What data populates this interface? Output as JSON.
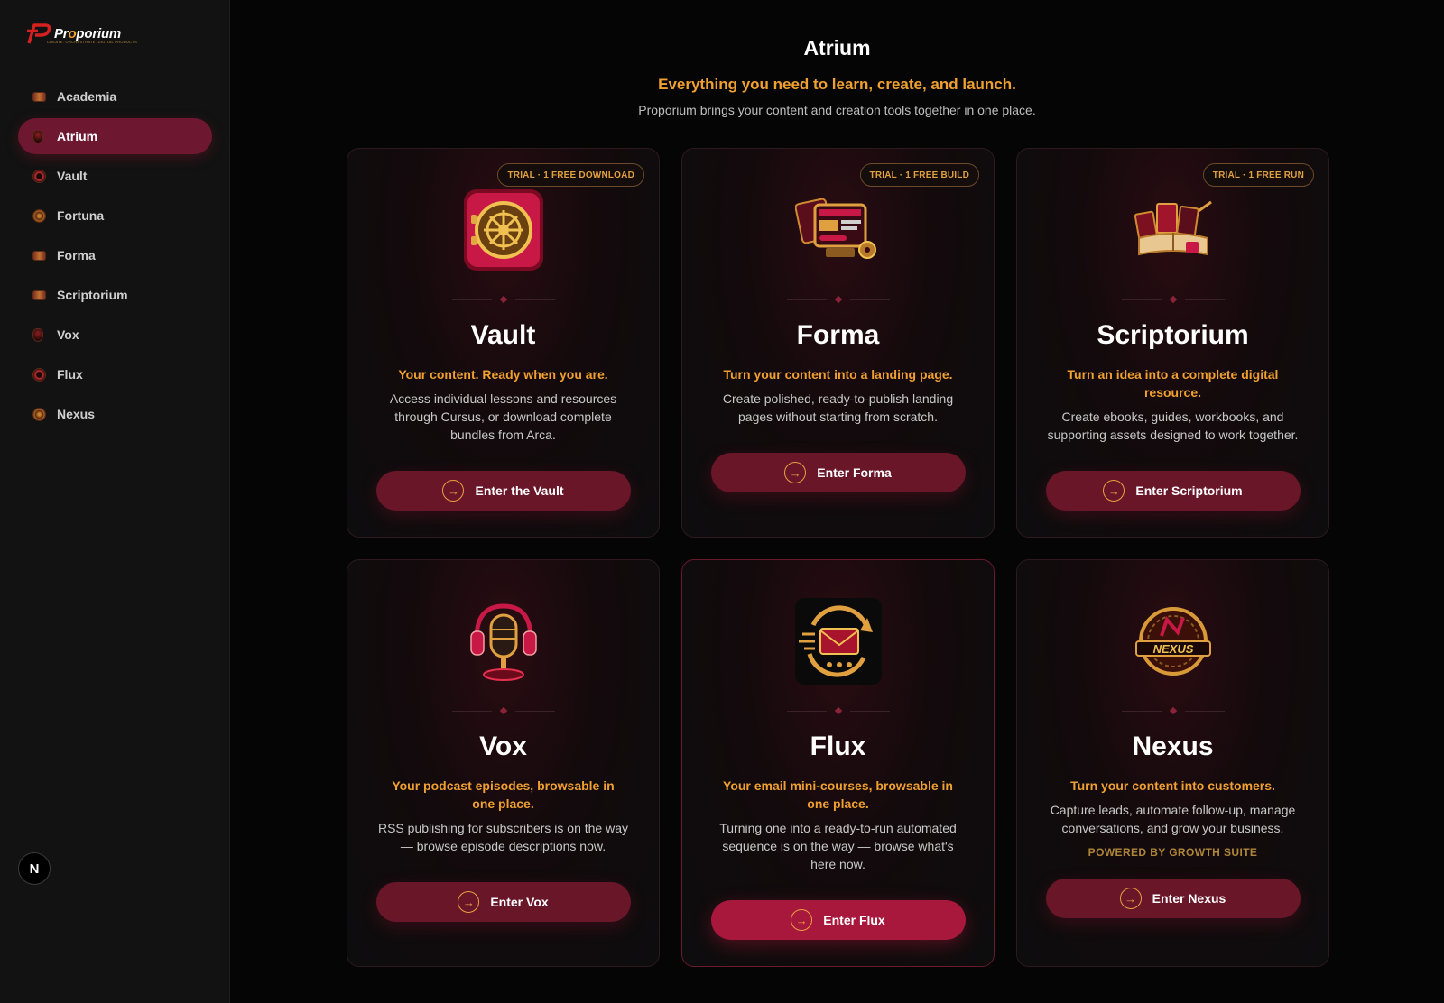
{
  "brand": {
    "name_prefix": "Pr",
    "name_o": "o",
    "name_suffix": "porium",
    "subtext": "CREATE. ORCHESTRATE. DIGITAL PRODUCTS"
  },
  "sidebar": {
    "items": [
      {
        "label": "Academia",
        "icon": "academia-icon"
      },
      {
        "label": "Atrium",
        "icon": "atrium-icon",
        "active": true
      },
      {
        "label": "Vault",
        "icon": "vault-icon"
      },
      {
        "label": "Fortuna",
        "icon": "fortuna-icon"
      },
      {
        "label": "Forma",
        "icon": "forma-icon"
      },
      {
        "label": "Scriptorium",
        "icon": "scriptorium-icon"
      },
      {
        "label": "Vox",
        "icon": "vox-icon"
      },
      {
        "label": "Flux",
        "icon": "flux-icon"
      },
      {
        "label": "Nexus",
        "icon": "nexus-icon"
      }
    ],
    "badge": "N"
  },
  "header": {
    "title": "Atrium",
    "tagline": "Everything you need to learn, create, and launch.",
    "description": "Proporium brings your content and creation tools together in one place."
  },
  "cards": [
    {
      "badge": "TRIAL · 1 FREE DOWNLOAD",
      "title": "Vault",
      "tagline": "Your content. Ready when you are.",
      "description": "Access individual lessons and resources through Cursus, or download complete bundles from Arca.",
      "button": "Enter the Vault",
      "icon": "vault-safe-icon"
    },
    {
      "badge": "TRIAL · 1 FREE BUILD",
      "title": "Forma",
      "tagline": "Turn your content into a landing page.",
      "description": "Create polished, ready-to-publish landing pages without starting from scratch.",
      "button": "Enter Forma",
      "icon": "landing-page-icon"
    },
    {
      "badge": "TRIAL · 1 FREE RUN",
      "title": "Scriptorium",
      "tagline": "Turn an idea into a complete digital resource.",
      "description": "Create ebooks, guides, workbooks, and supporting assets designed to work together.",
      "button": "Enter Scriptorium",
      "icon": "books-icon"
    },
    {
      "title": "Vox",
      "tagline": "Your podcast episodes, browsable in one place.",
      "description": "RSS publishing for subscribers is on the way — browse episode descriptions now.",
      "button": "Enter Vox",
      "icon": "microphone-icon"
    },
    {
      "title": "Flux",
      "tagline": "Your email mini-courses, browsable in one place.",
      "description": "Turning one into a ready-to-run automated sequence is on the way — browse what's here now.",
      "button": "Enter Flux",
      "icon": "email-icon"
    },
    {
      "title": "Nexus",
      "tagline": "Turn your content into customers.",
      "description": "Capture leads, automate follow-up, manage conversations, and grow your business.",
      "powered": "POWERED BY GROWTH SUITE",
      "button": "Enter Nexus",
      "icon": "nexus-emblem-icon"
    }
  ],
  "colors": {
    "accent": "#f0a030",
    "button": "#6a1629",
    "button_hot": "#a8183c",
    "active_nav": "#6e1730"
  }
}
